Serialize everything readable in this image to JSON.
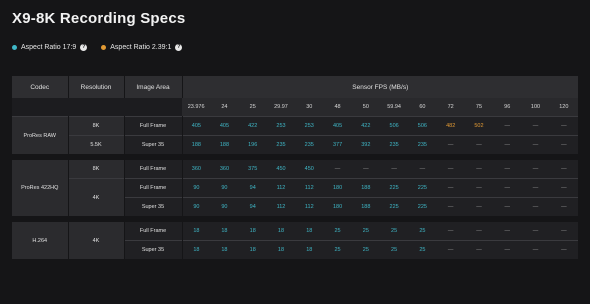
{
  "title": "X9-8K Recording Specs",
  "legend": [
    {
      "label": "Aspect Ratio 17:9",
      "color": "#3fb7c7",
      "help": "?"
    },
    {
      "label": "Aspect Ratio 2.39:1",
      "color": "#e29a34",
      "help": "?"
    }
  ],
  "headers": {
    "codec": "Codec",
    "resolution": "Resolution",
    "image_area": "Image Area",
    "fps": "Sensor FPS (MB/s)"
  },
  "fps_values": [
    "23.976",
    "24",
    "25",
    "29.97",
    "30",
    "48",
    "50",
    "59.94",
    "60",
    "72",
    "75",
    "96",
    "100",
    "120"
  ],
  "groups": [
    {
      "codec": "ProRes RAW",
      "resolutions": [
        {
          "resolution": "8K",
          "rows": [
            {
              "area": "Full Frame",
              "values": [
                "405",
                "405",
                "422",
                "253",
                "253",
                "405",
                "422",
                "506",
                "506",
                "482",
                "502",
                "—",
                "—",
                "—"
              ],
              "colors": [
                "c",
                "c",
                "c",
                "c",
                "c",
                "c",
                "c",
                "c",
                "c",
                "o",
                "o",
                "d",
                "d",
                "d"
              ]
            }
          ]
        },
        {
          "resolution": "5.5K",
          "rows": [
            {
              "area": "Super 35",
              "values": [
                "188",
                "188",
                "196",
                "235",
                "235",
                "377",
                "392",
                "235",
                "235",
                "—",
                "—",
                "—",
                "—",
                "—"
              ],
              "colors": [
                "c",
                "c",
                "c",
                "c",
                "c",
                "c",
                "c",
                "c",
                "c",
                "d",
                "d",
                "d",
                "d",
                "d"
              ]
            }
          ]
        }
      ]
    },
    {
      "codec": "ProRes 422HQ",
      "resolutions": [
        {
          "resolution": "8K",
          "rows": [
            {
              "area": "Full Frame",
              "values": [
                "360",
                "360",
                "375",
                "450",
                "450",
                "—",
                "—",
                "—",
                "—",
                "—",
                "—",
                "—",
                "—",
                "—"
              ],
              "colors": [
                "c",
                "c",
                "c",
                "c",
                "c",
                "d",
                "d",
                "d",
                "d",
                "d",
                "d",
                "d",
                "d",
                "d"
              ]
            }
          ]
        },
        {
          "resolution": "4K",
          "rows": [
            {
              "area": "Full Frame",
              "values": [
                "90",
                "90",
                "94",
                "112",
                "112",
                "180",
                "188",
                "225",
                "225",
                "—",
                "—",
                "—",
                "—",
                "—"
              ],
              "colors": [
                "c",
                "c",
                "c",
                "c",
                "c",
                "c",
                "c",
                "c",
                "c",
                "d",
                "d",
                "d",
                "d",
                "d"
              ]
            },
            {
              "area": "Super 35",
              "values": [
                "90",
                "90",
                "94",
                "112",
                "112",
                "180",
                "188",
                "225",
                "225",
                "—",
                "—",
                "—",
                "—",
                "—"
              ],
              "colors": [
                "c",
                "c",
                "c",
                "c",
                "c",
                "c",
                "c",
                "c",
                "c",
                "d",
                "d",
                "d",
                "d",
                "d"
              ]
            }
          ]
        }
      ]
    },
    {
      "codec": "H.264",
      "resolutions": [
        {
          "resolution": "4K",
          "rows": [
            {
              "area": "Full Frame",
              "values": [
                "18",
                "18",
                "18",
                "18",
                "18",
                "25",
                "25",
                "25",
                "25",
                "—",
                "—",
                "—",
                "—",
                "—"
              ],
              "colors": [
                "c",
                "c",
                "c",
                "c",
                "c",
                "c",
                "c",
                "c",
                "c",
                "d",
                "d",
                "d",
                "d",
                "d"
              ]
            },
            {
              "area": "Super 35",
              "values": [
                "18",
                "18",
                "18",
                "18",
                "18",
                "25",
                "25",
                "25",
                "25",
                "—",
                "—",
                "—",
                "—",
                "—"
              ],
              "colors": [
                "c",
                "c",
                "c",
                "c",
                "c",
                "c",
                "c",
                "c",
                "c",
                "d",
                "d",
                "d",
                "d",
                "d"
              ]
            }
          ]
        }
      ]
    }
  ]
}
